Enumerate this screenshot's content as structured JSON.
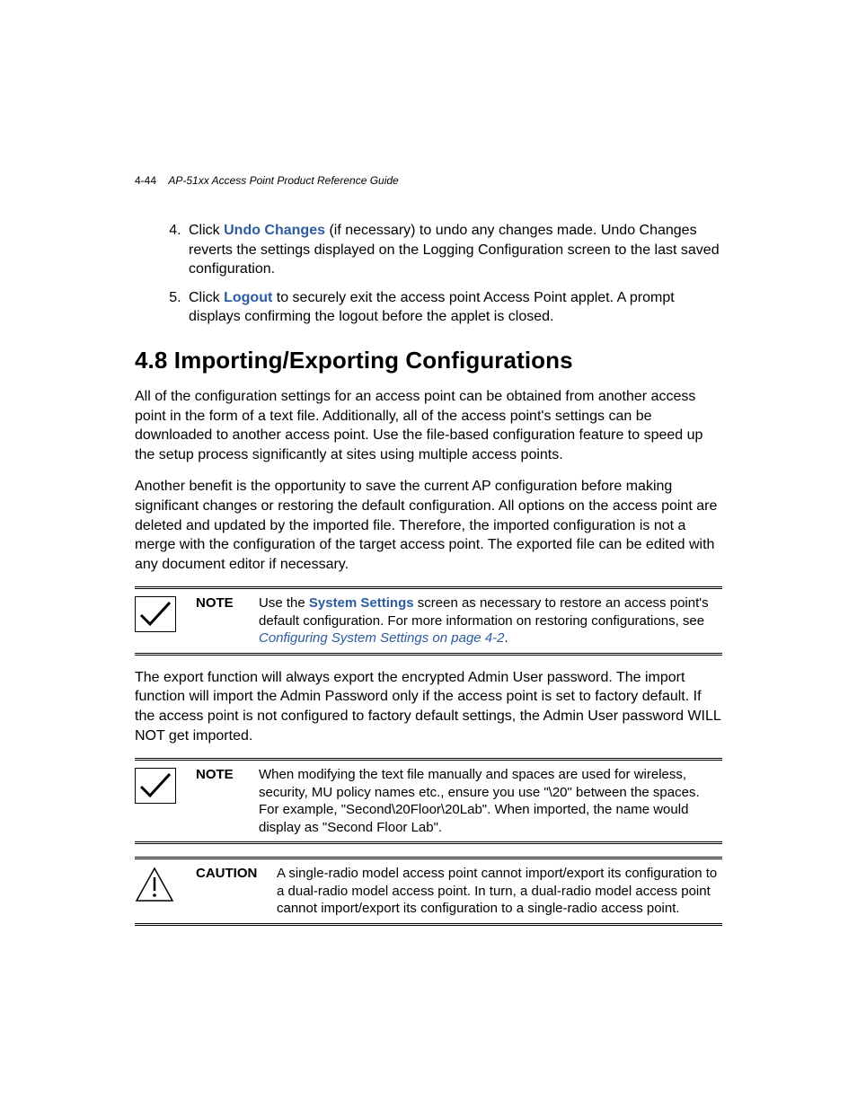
{
  "header": {
    "page_number": "4-44",
    "title": "AP-51xx Access Point Product Reference Guide"
  },
  "steps": {
    "start": 4,
    "items": [
      {
        "pre": "Click ",
        "bold": "Undo Changes",
        "post": " (if necessary) to undo any changes made. Undo Changes reverts the settings displayed on the Logging Configuration screen to the last saved configuration."
      },
      {
        "pre": "Click ",
        "bold": "Logout",
        "post": " to securely exit the access point Access Point applet. A prompt displays confirming the logout before the applet is closed."
      }
    ]
  },
  "section": {
    "number": "4.8",
    "title": "Importing/Exporting Configurations"
  },
  "paras": {
    "p1": "All of the configuration settings for an access point can be obtained from another access point in the form of a text file. Additionally, all of the access point's settings can be downloaded to another access point. Use the file-based configuration feature to speed up the setup process significantly at sites using multiple access points.",
    "p2": "Another benefit is the opportunity to save the current AP configuration before making significant changes or restoring the default configuration. All options on the access point are deleted and updated by the imported file. Therefore, the imported configuration is not a merge with the configuration of the target access point. The exported file can be edited with any document editor if necessary.",
    "p3": "The export function will always export the encrypted Admin User password. The import function will import the Admin Password only if the access point is set to factory default. If the access point is not configured to factory default settings, the Admin User password WILL NOT get imported."
  },
  "note1": {
    "label": "NOTE",
    "text_pre": "Use the ",
    "bold": "System Settings",
    "text_mid": " screen as necessary to restore an access point's default configuration. For more information on restoring configurations, see ",
    "xref": "Configuring System Settings on page 4-2",
    "text_post": "."
  },
  "note2": {
    "label": "NOTE",
    "text": "When modifying the text file manually and spaces are used for wireless, security, MU policy names etc., ensure you use \"\\20\" between the spaces. For example, \"Second\\20Floor\\20Lab\". When imported, the name would display as \"Second Floor Lab\"."
  },
  "caution": {
    "label": "CAUTION",
    "text": "A single-radio model access point cannot import/export its configuration to a dual-radio model access point. In turn, a dual-radio model access point cannot import/export its configuration to a single-radio access point."
  }
}
